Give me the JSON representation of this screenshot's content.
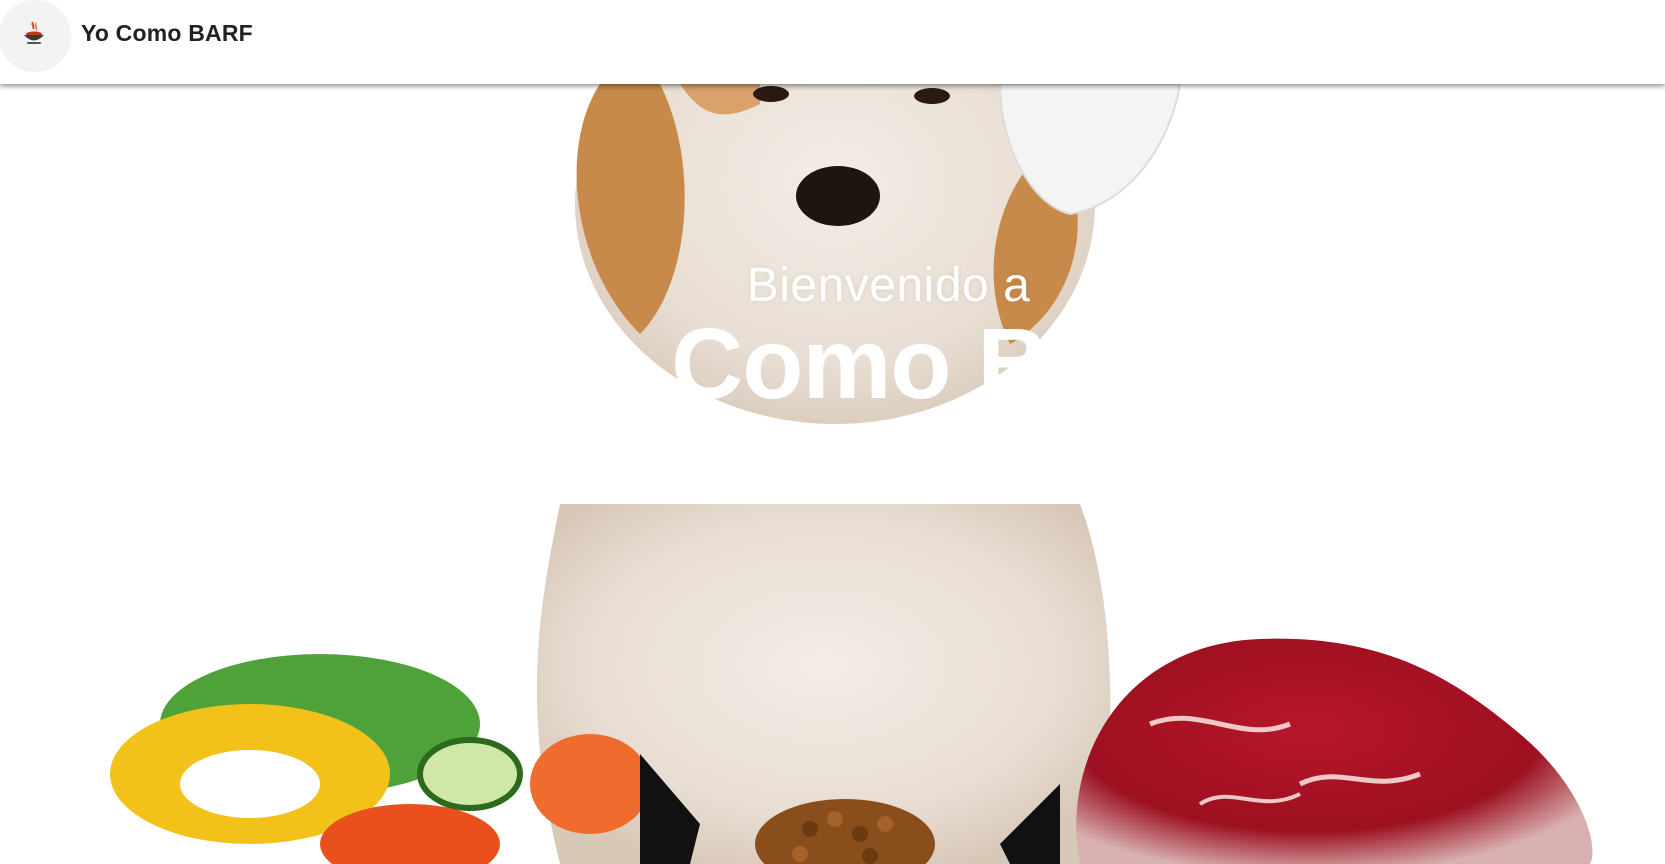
{
  "header": {
    "logo_icon": "bowl-icon",
    "brand_name": "Yo Como BARF"
  },
  "hero": {
    "welcome": "Bienvenido a",
    "title": "Yo Como BARF",
    "scroll_icon": "double-chevron-down-icon"
  }
}
